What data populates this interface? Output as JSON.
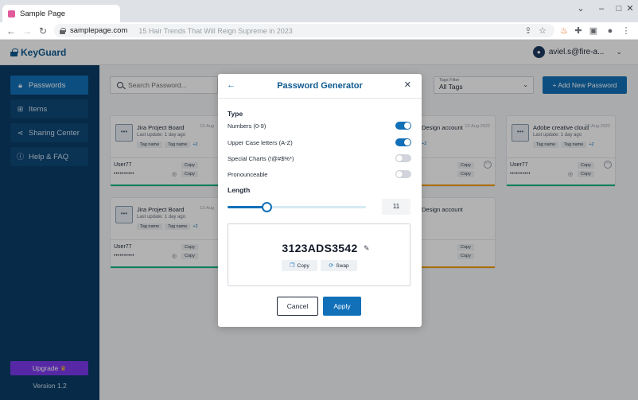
{
  "browser": {
    "tab_title": "Sample Page",
    "url": "samplepage.com",
    "page_title_hint": "15 Hair Trends That Will Reign Supreme in 2023",
    "icons": [
      "back-arrow-icon",
      "forward-arrow-icon",
      "reload-icon",
      "lock-icon",
      "share-icon",
      "star-icon",
      "extension-icon",
      "puzzle-icon",
      "sidebar-icon",
      "profile-icon",
      "kebab-menu-icon"
    ]
  },
  "app": {
    "brand": "KeyGuard",
    "user_email": "aviel.s@fire-a...",
    "sidebar": {
      "items": [
        {
          "label": "Passwords",
          "icon": "lock-icon",
          "active": true
        },
        {
          "label": "Items",
          "icon": "grid-icon",
          "active": false
        },
        {
          "label": "Sharing Center",
          "icon": "share-icon",
          "active": false
        },
        {
          "label": "Help & FAQ",
          "icon": "info-icon",
          "active": false
        }
      ],
      "upgrade_label": "Upgrade",
      "version": "Version 1.2"
    },
    "toolbar": {
      "search_placeholder": "Search Password...",
      "filter_caption": "Tags Filter",
      "filter_value": "All Tags",
      "add_label": "+ Add New Password"
    },
    "cards": [
      {
        "name": "Jira Project Board",
        "date": "12-Aug",
        "update": "Last update: 1 day ago",
        "tags": [
          "Tag name",
          "Tag name"
        ],
        "more": "+2",
        "user": "User77",
        "password_mask": "••••••••••",
        "copy": "Copy",
        "stripe": "#10b981"
      },
      {
        "name": "Design account",
        "date": "12-Aug-2022",
        "update": "",
        "tags": [],
        "more": "+2",
        "user": "",
        "password_mask": "",
        "copy": "Copy",
        "stripe": "#f59e0b"
      },
      {
        "name": "Adobe creative cloud",
        "date": "12-Aug-2022",
        "update": "Last update: 1 day ago",
        "tags": [
          "Tag name",
          "Tag name"
        ],
        "more": "+2",
        "user": "User77",
        "password_mask": "••••••••••",
        "copy": "Copy",
        "stripe": "#10b981"
      },
      {
        "name": "Jira Project Board",
        "date": "12-Aug",
        "update": "Last update: 1 day ago",
        "tags": [
          "Tag name",
          "Tag name"
        ],
        "more": "+2",
        "user": "User77",
        "password_mask": "••••••••••",
        "copy": "Copy",
        "stripe": "#10b981"
      },
      {
        "name": "Design account",
        "date": "12-Aug-2022",
        "update": "",
        "tags": [],
        "more": "",
        "user": "",
        "password_mask": "",
        "copy": "Copy",
        "stripe": "#f59e0b"
      }
    ]
  },
  "modal": {
    "title": "Password Generator",
    "type_heading": "Type",
    "options": [
      {
        "label": "Numbers (0-9)",
        "on": true
      },
      {
        "label": "Upper Case letters (A-Z)",
        "on": true
      },
      {
        "label": "Special Charts (!@#$%*)",
        "on": false
      },
      {
        "label": "Pronounceable",
        "on": false
      }
    ],
    "length_heading": "Length",
    "length_value": "11",
    "length_fraction": 0.28,
    "generated_password": "3123ADS3542",
    "copy_label": "Copy",
    "swap_label": "Swap",
    "cancel_label": "Cancel",
    "apply_label": "Apply"
  },
  "colors": {
    "primary": "#1270b8",
    "sidebar_bg": "#0a3d66",
    "upgrade": "#7c3aed"
  }
}
